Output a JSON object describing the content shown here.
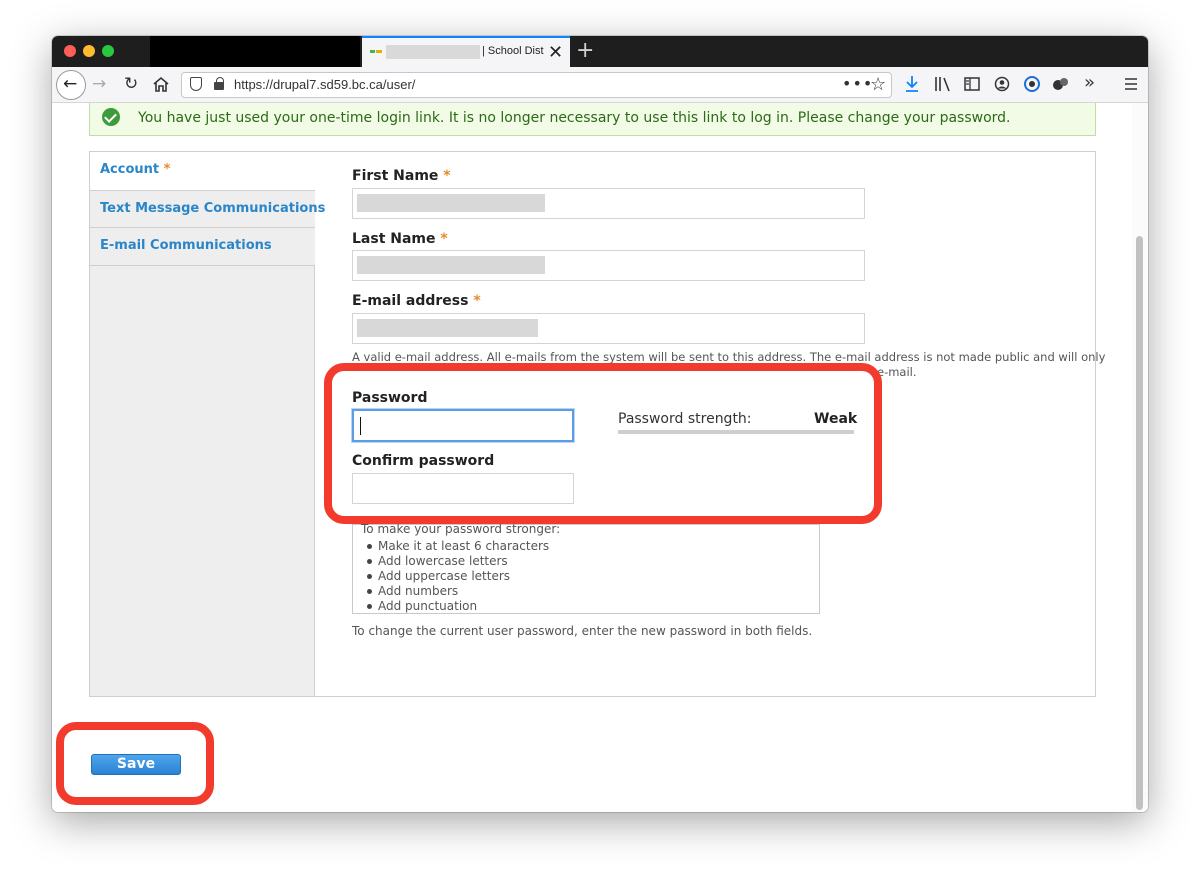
{
  "browser": {
    "tab_active_title": "| School Dist",
    "tab_close": "✕",
    "new_tab": "+",
    "url": "https://drupal7.sd59.bc.ca/user/",
    "url_more": "•••",
    "colors": {
      "tab_accent": "#0a84ff"
    }
  },
  "message": {
    "text": "You have just used your one-time login link. It is no longer necessary to use this link to log in. Please change your password."
  },
  "vertical_tabs": [
    {
      "label": "Account",
      "required_marker": "*"
    },
    {
      "label": "Text Message Communications"
    },
    {
      "label": "E-mail Communications"
    }
  ],
  "form": {
    "first_name_label": "First Name",
    "last_name_label": "Last Name",
    "email_label": "E-mail address",
    "required_marker": "*",
    "email_description_line1": "A valid e-mail address. All e-mails from the system will be sent to this address. The e-mail address is not made public and will only",
    "email_description_line2_end": "e-mail.",
    "password_label": "Password",
    "confirm_password_label": "Confirm password",
    "password_strength_label": "Password strength:",
    "password_strength_value": "Weak",
    "password_strength_fraction": 0.0,
    "suggestions_title": "To make your password stronger:",
    "suggestions": [
      "Make it at least 6 characters",
      "Add lowercase letters",
      "Add uppercase letters",
      "Add numbers",
      "Add punctuation"
    ],
    "password_description": "To change the current user password, enter the new password in both fields.",
    "save_label": "Save"
  },
  "colors": {
    "accent_link": "#2a86c8",
    "required": "#e58a29",
    "annotation": "#f23b2c",
    "success": "#3e9b3c"
  }
}
